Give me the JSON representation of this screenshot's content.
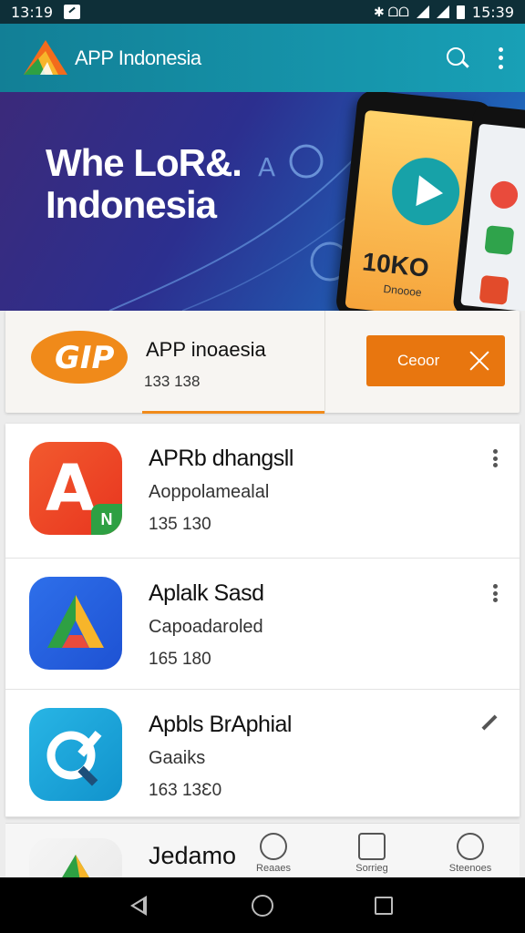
{
  "status_bar": {
    "time_left": "13:19",
    "time_right": "15:39",
    "icons": [
      "notification-icon",
      "bluetooth-icon",
      "vibrate-icon",
      "wifi-icon",
      "signal-icon",
      "battery-icon"
    ],
    "indicators": "✱ ᗝᗝ"
  },
  "app_bar": {
    "title": "APP Indonesia",
    "background": "#1690a8"
  },
  "banner": {
    "headline_line1": "Whe LoR&.",
    "headline_line2": "Indonesia",
    "phone_text": "10KO",
    "phone_subtext": "Dnoooe"
  },
  "promo": {
    "logo_text": "GIP",
    "name": "APP inoaesia",
    "meta": "133 138",
    "button_label": "Ceoor",
    "accent": "#e8760f"
  },
  "apps": [
    {
      "name": "APRb dhangsll",
      "developer": "Aoppolamealal",
      "meta": "135 130",
      "badge": "N"
    },
    {
      "name": "Aplalk Sasd",
      "developer": "Capoadaroled",
      "meta": "165 180"
    },
    {
      "name": "Apbls BrAphial",
      "developer": "Gaaiks",
      "meta": "163 13Ɛ0"
    }
  ],
  "partial_app": {
    "name": "Jedamo"
  },
  "bottom_tabs": [
    {
      "label": "Reaaes"
    },
    {
      "label": "Sorrieg"
    },
    {
      "label": "Steenoes"
    }
  ]
}
